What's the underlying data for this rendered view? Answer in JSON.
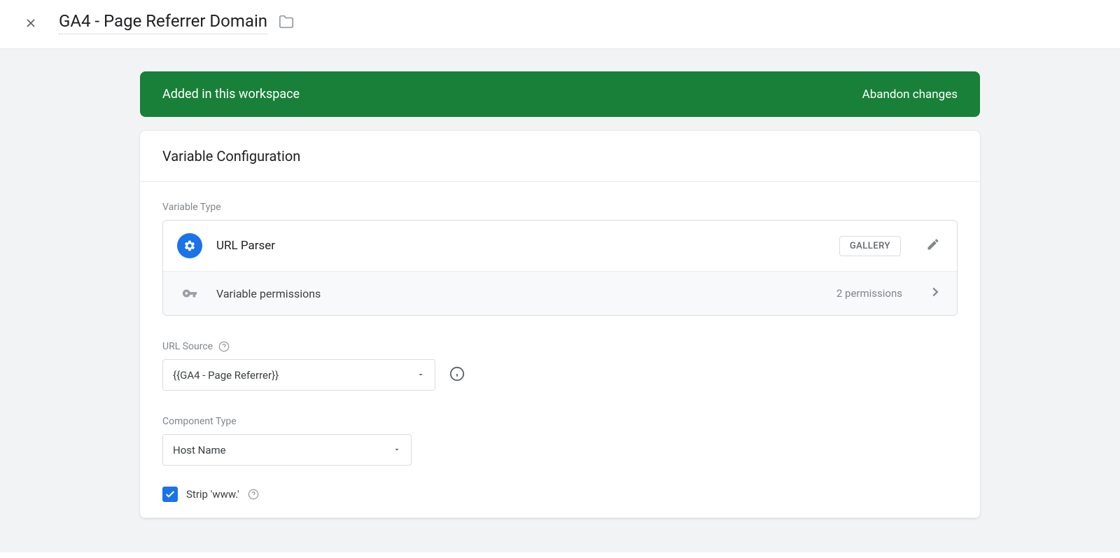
{
  "header": {
    "title": "GA4 - Page Referrer Domain"
  },
  "banner": {
    "message": "Added in this workspace",
    "action": "Abandon changes"
  },
  "card": {
    "title": "Variable Configuration",
    "variableTypeLabel": "Variable Type",
    "type": {
      "name": "URL Parser",
      "galleryLabel": "GALLERY"
    },
    "permissions": {
      "label": "Variable permissions",
      "count": "2 permissions"
    },
    "urlSource": {
      "label": "URL Source",
      "value": "{{GA4 - Page Referrer}}"
    },
    "componentType": {
      "label": "Component Type",
      "value": "Host Name"
    },
    "stripWww": {
      "label": "Strip 'www.'",
      "checked": true
    }
  }
}
